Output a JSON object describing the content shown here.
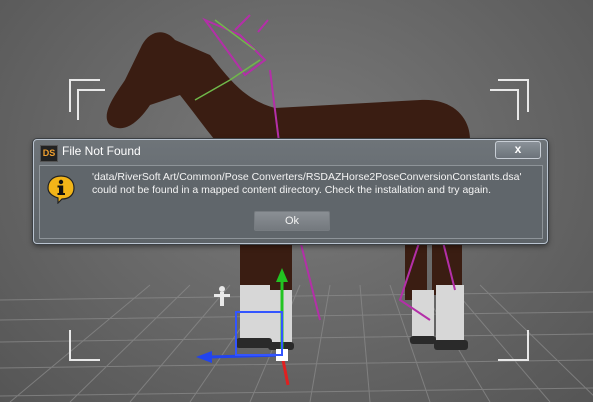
{
  "dialog": {
    "title": "File Not Found",
    "app_logo_text": "DS",
    "close_label": "x",
    "message_line1": "'data/RiverSoft Art/Common/Pose Converters/RSDAZHorse2PoseConversionConstants.dsa'",
    "message_line2": "could not be found in a mapped content directory. Check the installation and try again.",
    "ok_label": "Ok",
    "icon": "info-icon"
  },
  "colors": {
    "viewport_background": "#6a6a6a",
    "horse_body": "#3a1d12",
    "dialog_background": "#60666b",
    "info_icon_fill": "#f2b418"
  }
}
